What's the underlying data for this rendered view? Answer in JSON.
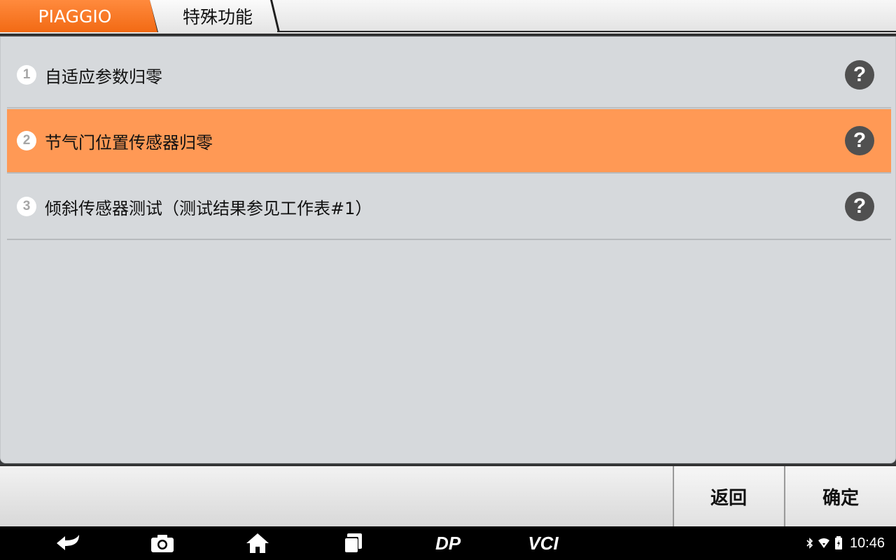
{
  "breadcrumb": {
    "brand": "PIAGGIO",
    "current": "特殊功能"
  },
  "menu": {
    "items": [
      {
        "number": "1",
        "label": "自适应参数归零",
        "selected": false
      },
      {
        "number": "2",
        "label": "节气门位置传感器归零",
        "selected": true
      },
      {
        "number": "3",
        "label": "倾斜传感器测试（测试结果参见工作表#1）",
        "selected": false
      }
    ],
    "help_glyph": "?"
  },
  "actions": {
    "back_label": "返回",
    "confirm_label": "确定"
  },
  "navbar": {
    "icons": [
      "back-icon",
      "camera-icon",
      "home-icon",
      "recent-apps-icon",
      "dp-logo-icon",
      "vci-icon"
    ],
    "dp_text": "DP",
    "vci_text": "VCI"
  },
  "status_bar": {
    "icons": [
      "bluetooth-icon",
      "wifi-icon",
      "battery-icon"
    ],
    "time": "10:46"
  },
  "colors": {
    "accent_orange": "#f26a14",
    "selected_row": "#ff9955",
    "panel_bg": "#d6d9dc"
  }
}
